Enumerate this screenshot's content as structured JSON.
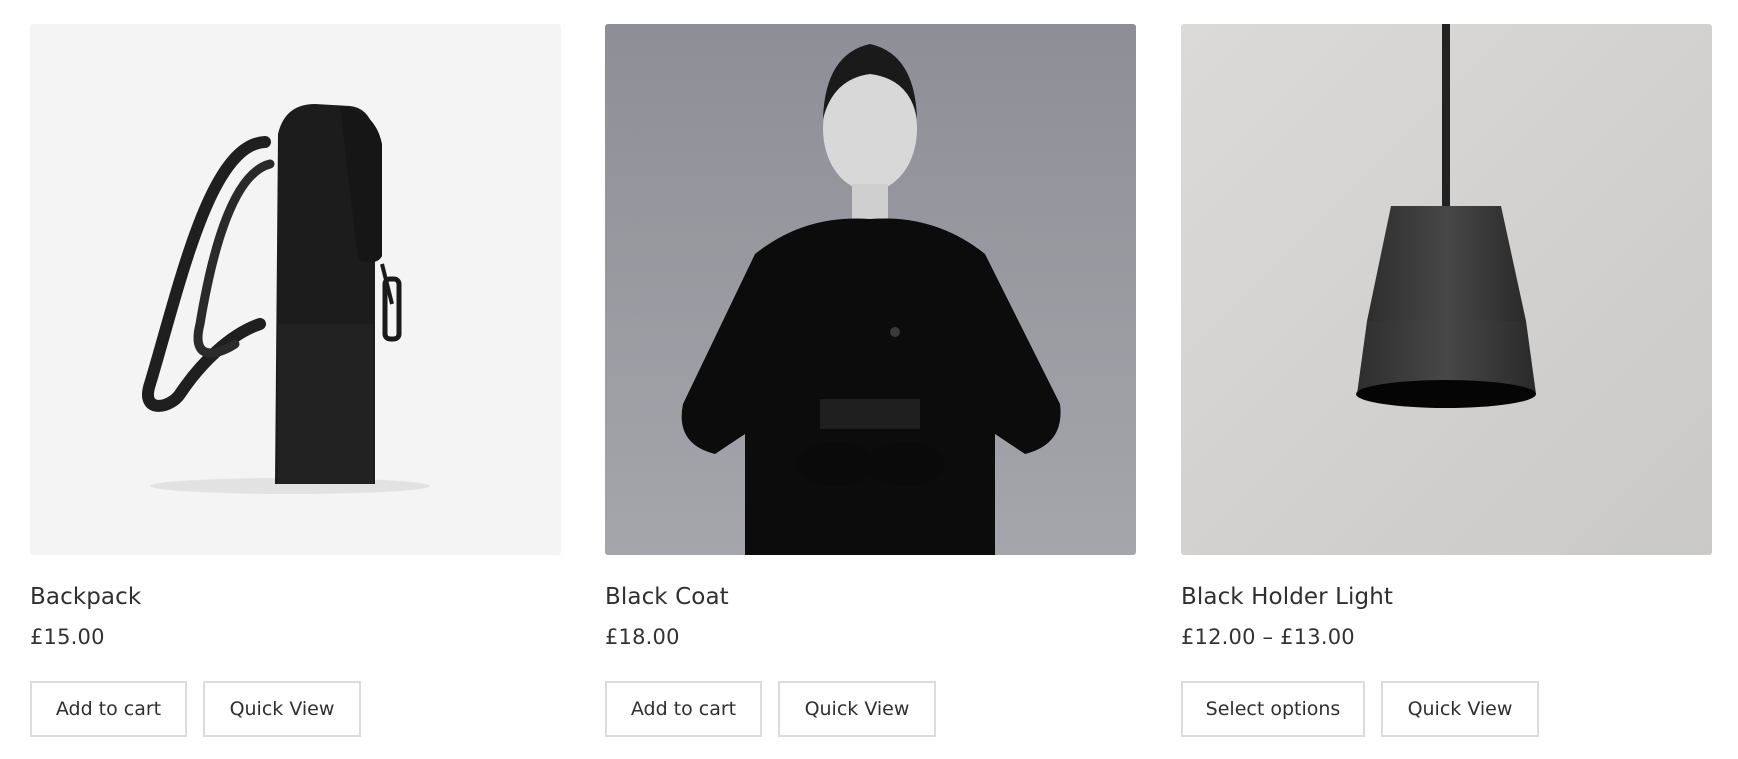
{
  "products": [
    {
      "name": "Backpack",
      "price": "£15.00",
      "primary_action": "Add to cart",
      "quick_view": "Quick View",
      "image": "backpack-photo"
    },
    {
      "name": "Black Coat",
      "price": "£18.00",
      "primary_action": "Add to cart",
      "quick_view": "Quick View",
      "image": "black-coat-photo"
    },
    {
      "name": "Black Holder Light",
      "price": "£12.00 – £13.00",
      "primary_action": "Select options",
      "quick_view": "Quick View",
      "image": "pendant-light-photo"
    }
  ],
  "colors": {
    "button_border": "#dcdcdc",
    "text": "#2f2f2f"
  }
}
